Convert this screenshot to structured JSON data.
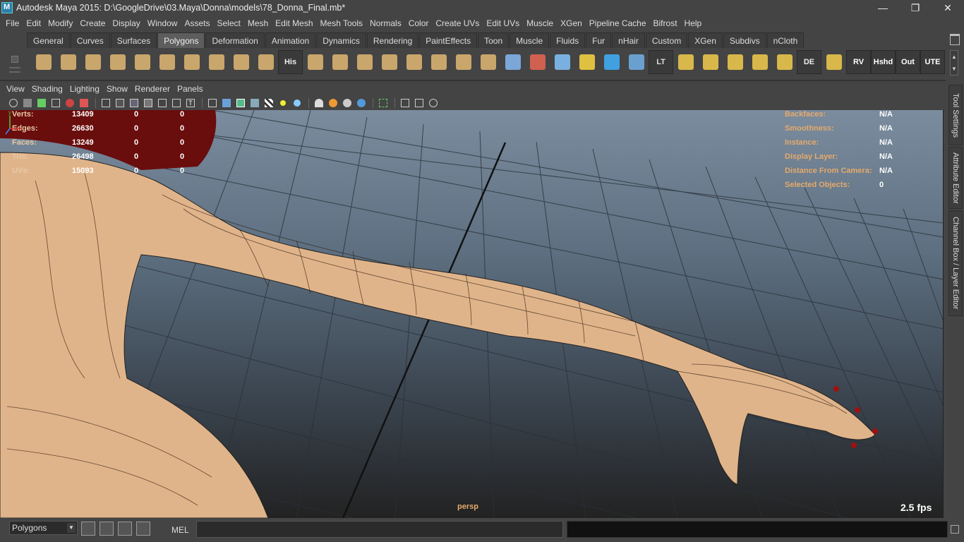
{
  "window": {
    "title": "Autodesk Maya 2015: D:\\GoogleDrive\\03.Maya\\Donna\\models\\78_Donna_Final.mb*",
    "controls": [
      "—",
      "❐",
      "✕"
    ]
  },
  "menubar": {
    "items": [
      "File",
      "Edit",
      "Modify",
      "Create",
      "Display",
      "Window",
      "Assets",
      "Select",
      "Mesh",
      "Edit Mesh",
      "Mesh Tools",
      "Normals",
      "Color",
      "Create UVs",
      "Edit UVs",
      "Muscle",
      "XGen",
      "Pipeline Cache",
      "Bifrost",
      "Help"
    ]
  },
  "shelf": {
    "tabs": [
      "General",
      "Curves",
      "Surfaces",
      "Polygons",
      "Deformation",
      "Animation",
      "Dynamics",
      "Rendering",
      "PaintEffects",
      "Toon",
      "Muscle",
      "Fluids",
      "Fur",
      "nHair",
      "Custom",
      "XGen",
      "Subdivs",
      "nCloth"
    ],
    "active_tab": "Polygons",
    "icons": [
      {
        "name": "poly-sphere-icon",
        "color": "#c9a66b",
        "label": ""
      },
      {
        "name": "poly-cube-icon",
        "color": "#c9a66b",
        "label": ""
      },
      {
        "name": "poly-cylinder-icon",
        "color": "#c9a66b",
        "label": ""
      },
      {
        "name": "poly-cone-icon",
        "color": "#c9a66b",
        "label": ""
      },
      {
        "name": "poly-plane-icon",
        "color": "#c9a66b",
        "label": ""
      },
      {
        "name": "poly-torus-icon",
        "color": "#c9a66b",
        "label": ""
      },
      {
        "name": "poly-pyramid-icon",
        "color": "#c9a66b",
        "label": ""
      },
      {
        "name": "poly-pipe-icon",
        "color": "#c9a66b",
        "label": ""
      },
      {
        "name": "poly-helix-icon",
        "color": "#c9a66b",
        "label": ""
      },
      {
        "name": "poly-soccerball-icon",
        "color": "#c9a66b",
        "label": ""
      },
      {
        "name": "history-icon",
        "color": "#eeeeee",
        "label": "His"
      },
      {
        "name": "extrude-icon",
        "color": "#c9a66b",
        "label": ""
      },
      {
        "name": "bevel-icon",
        "color": "#c9a66b",
        "label": ""
      },
      {
        "name": "bridge-icon",
        "color": "#c9a66b",
        "label": ""
      },
      {
        "name": "split-edge-icon",
        "color": "#c9a66b",
        "label": ""
      },
      {
        "name": "merge-icon",
        "color": "#c9a66b",
        "label": ""
      },
      {
        "name": "append-polygon-icon",
        "color": "#c9a66b",
        "label": ""
      },
      {
        "name": "planar-map-icon",
        "color": "#c9a66b",
        "label": ""
      },
      {
        "name": "combine-icon",
        "color": "#c9a66b",
        "label": ""
      },
      {
        "name": "smooth-icon",
        "color": "#7aa6d8",
        "label": ""
      },
      {
        "name": "sculpt-brush-icon",
        "color": "#d06050",
        "label": ""
      },
      {
        "name": "lattice-icon",
        "color": "#7ab0e0",
        "label": ""
      },
      {
        "name": "pivot-icon",
        "color": "#e0c040",
        "label": ""
      },
      {
        "name": "manipulator-icon",
        "color": "#40a0e0",
        "label": ""
      },
      {
        "name": "mesh-display-icon",
        "color": "#6aa0d0",
        "label": ""
      },
      {
        "name": "lt-icon",
        "color": "#dddddd",
        "label": "LT"
      },
      {
        "name": "uv-editor-icon",
        "color": "#d8b84a",
        "label": ""
      },
      {
        "name": "uv-cut-icon",
        "color": "#d8b84a",
        "label": ""
      },
      {
        "name": "uv-sew-icon",
        "color": "#d8b84a",
        "label": ""
      },
      {
        "name": "uv-select-icon",
        "color": "#d8b84a",
        "label": ""
      },
      {
        "name": "uv-move-icon",
        "color": "#d8b84a",
        "label": ""
      },
      {
        "name": "de-icon",
        "color": "#eeeeee",
        "label": "DE"
      },
      {
        "name": "grid-uv-icon",
        "color": "#d8b84a",
        "label": ""
      },
      {
        "name": "rv-icon",
        "color": "#ffffff",
        "label": "RV"
      },
      {
        "name": "hshd-icon",
        "color": "#ffffff",
        "label": "Hshd"
      },
      {
        "name": "out-icon",
        "color": "#ffffff",
        "label": "Out"
      },
      {
        "name": "ute-icon",
        "color": "#ffffff",
        "label": "UTE"
      }
    ]
  },
  "panel": {
    "menu": [
      "View",
      "Shading",
      "Lighting",
      "Show",
      "Renderer",
      "Panels"
    ]
  },
  "hud_left": [
    {
      "label": "Verts:",
      "values": [
        "13409",
        "0",
        "0"
      ]
    },
    {
      "label": "Edges:",
      "values": [
        "26630",
        "0",
        "0"
      ]
    },
    {
      "label": "Faces:",
      "values": [
        "13249",
        "0",
        "0"
      ]
    },
    {
      "label": "Tris:",
      "values": [
        "26498",
        "0",
        "0"
      ]
    },
    {
      "label": "UVs:",
      "values": [
        "15093",
        "0",
        "0"
      ]
    }
  ],
  "hud_right": [
    {
      "label": "Backfaces:",
      "value": "N/A"
    },
    {
      "label": "Smoothness:",
      "value": "N/A"
    },
    {
      "label": "Instance:",
      "value": "N/A"
    },
    {
      "label": "Display Layer:",
      "value": "N/A"
    },
    {
      "label": "Distance From Camera:",
      "value": "N/A"
    },
    {
      "label": "Selected Objects:",
      "value": "0"
    }
  ],
  "viewport": {
    "camera": "persp",
    "fps": "2.5 fps"
  },
  "right_tabs": [
    "Tool Settings",
    "Attribute Editor",
    "Channel Box / Layer Editor"
  ],
  "command_line": {
    "mode": "Polygons",
    "mel_label": "MEL"
  }
}
